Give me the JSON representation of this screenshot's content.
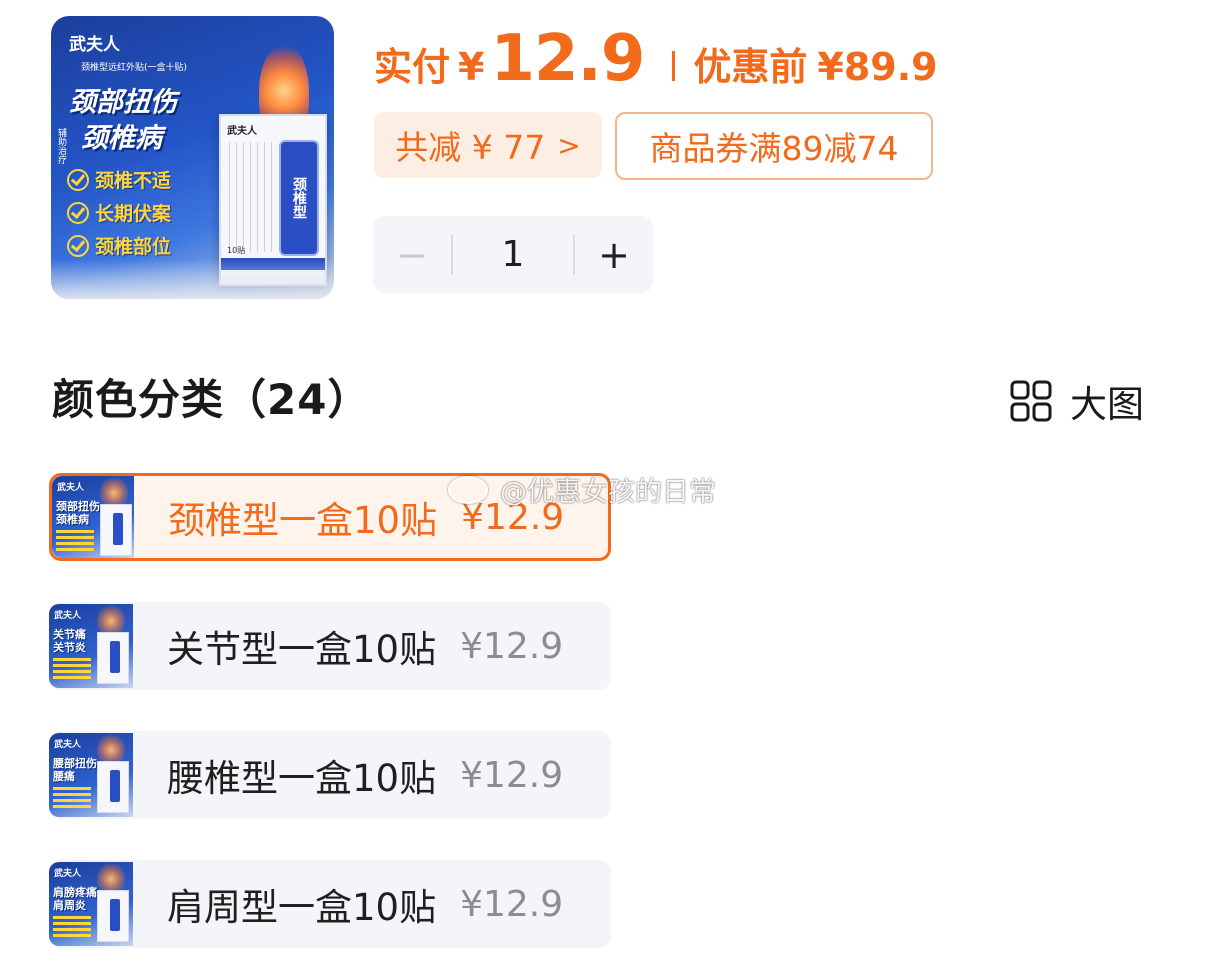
{
  "hero": {
    "brand": "武夫人",
    "subtitle": "颈椎型远红外贴(一盒十贴)",
    "headline_1": "颈部扭伤",
    "headline_2": "颈椎病",
    "side_text": "辅助治疗",
    "checks": [
      "颈椎不适",
      "长期伏案",
      "颈椎部位"
    ],
    "box_brand": "武夫人",
    "box_label": "颈椎型",
    "box_count": "10贴"
  },
  "price": {
    "paid_label": "实付",
    "currency": "¥",
    "paid_value": "12.9",
    "before_label": "优惠前",
    "before_value": "¥89.9"
  },
  "discount": {
    "total_label": "共减 ¥ 77",
    "chevron": ">",
    "coupon_label": "商品券满89减74"
  },
  "quantity": {
    "minus": "−",
    "value": "1",
    "plus": "+"
  },
  "section": {
    "title": "颜色分类（24）",
    "big_view_label": "大图"
  },
  "watermark": "@优惠女孩的日常",
  "options": [
    {
      "name": "颈椎型一盒10贴",
      "price": "¥12.9",
      "selected": true,
      "thumb_brand": "武夫人",
      "thumb_line_1": "颈部扭伤",
      "thumb_line_2": "颈椎病"
    },
    {
      "name": "关节型一盒10贴",
      "price": "¥12.9",
      "selected": false,
      "thumb_brand": "武夫人",
      "thumb_line_1": "关节痛",
      "thumb_line_2": "关节炎"
    },
    {
      "name": "腰椎型一盒10贴",
      "price": "¥12.9",
      "selected": false,
      "thumb_brand": "武夫人",
      "thumb_line_1": "腰部扭伤",
      "thumb_line_2": "腰痛"
    },
    {
      "name": "肩周型一盒10贴",
      "price": "¥12.9",
      "selected": false,
      "thumb_brand": "武夫人",
      "thumb_line_1": "肩膀疼痛",
      "thumb_line_2": "肩周炎"
    }
  ],
  "colors": {
    "accent": "#f26a1b",
    "accent_light": "#fdeee4",
    "muted_price": "#8a8d94",
    "option_bg": "#f4f5f8"
  },
  "icons": {
    "grid": "grid-four-squares-icon",
    "check": "check-circle-icon"
  }
}
